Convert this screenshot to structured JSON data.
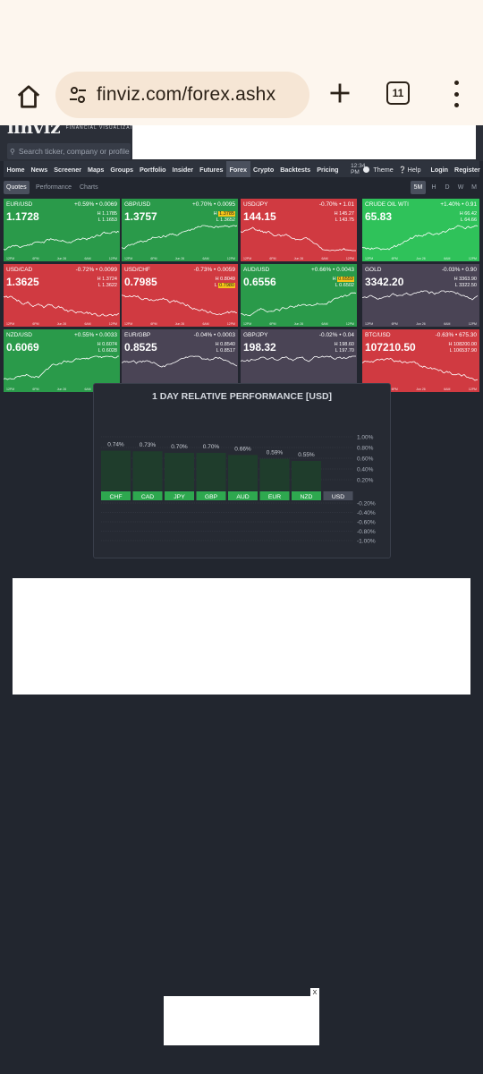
{
  "browser": {
    "url": "finviz.com/forex.ashx",
    "tab_count": "11"
  },
  "header": {
    "logo_text": "finviz",
    "logo_subtitle": "FINANCIAL VISUALIZATIONS",
    "search_placeholder": "Search ticker, company or profile"
  },
  "nav": {
    "items": [
      "Home",
      "News",
      "Screener",
      "Maps",
      "Groups",
      "Portfolio",
      "Insider",
      "Futures",
      "Forex",
      "Crypto",
      "Backtests",
      "Pricing"
    ],
    "active": "Forex",
    "time": "12:34 PM",
    "theme_label": "Theme",
    "help_label": "Help",
    "login_label": "Login",
    "register_label": "Register"
  },
  "subtabs": {
    "items": [
      "Quotes",
      "Performance",
      "Charts"
    ],
    "active": "Quotes",
    "timeframes": [
      "5M",
      "H",
      "D",
      "W",
      "M"
    ],
    "active_timeframe": "5M"
  },
  "axis_ticks": [
    "12PM",
    "6PM",
    "Jun 26",
    "6AM",
    "12PM"
  ],
  "tiles": [
    {
      "name": "EUR/USD",
      "change": "+0.59% • 0.0069",
      "price": "1.1728",
      "high": "1.1785",
      "low": "1.1653",
      "color": "#2a9a4a"
    },
    {
      "name": "GBP/USD",
      "change": "+0.70% • 0.0095",
      "price": "1.3757",
      "high": "1.3785",
      "low": "1.3652",
      "color": "#2a9a4a"
    },
    {
      "name": "USD/JPY",
      "change": "-0.70% • 1.01",
      "price": "144.15",
      "high": "145.27",
      "low": "143.75",
      "color": "#d03a41"
    },
    {
      "name": "CRUDE OIL WTI",
      "change": "+1.40% • 0.91",
      "price": "65.83",
      "high": "66.42",
      "low": "64.66",
      "color": "#2fc25a"
    },
    {
      "name": "USD/CAD",
      "change": "-0.72% • 0.0099",
      "price": "1.3625",
      "high": "1.3724",
      "low": "1.3622",
      "color": "#d03a41"
    },
    {
      "name": "USD/CHF",
      "change": "-0.73% • 0.0059",
      "price": "0.7985",
      "high": "0.8049",
      "low": "0.7980",
      "color": "#d03a41"
    },
    {
      "name": "AUD/USD",
      "change": "+0.66% • 0.0043",
      "price": "0.6556",
      "high": "0.6559",
      "low": "0.6502",
      "color": "#2a9a4a"
    },
    {
      "name": "GOLD",
      "change": "-0.03% • 0.90",
      "price": "3342.20",
      "high": "3363.90",
      "low": "3322.50",
      "color": "#4a4455"
    },
    {
      "name": "NZD/USD",
      "change": "+0.55% • 0.0033",
      "price": "0.6069",
      "high": "0.6074",
      "low": "0.6028",
      "color": "#2a9a4a"
    },
    {
      "name": "EUR/GBP",
      "change": "-0.04% • 0.0003",
      "price": "0.8525",
      "high": "0.8540",
      "low": "0.8517",
      "color": "#4a4455"
    },
    {
      "name": "GBP/JPY",
      "change": "-0.02% • 0.04",
      "price": "198.32",
      "high": "198.60",
      "low": "197.70",
      "color": "#4a4455"
    },
    {
      "name": "BTC/USD",
      "change": "-0.63% • 675.30",
      "price": "107210.50",
      "high": "108200.00",
      "low": "106537.90",
      "color": "#d03a41"
    }
  ],
  "tile_labels": {
    "high": "H",
    "low": "L"
  },
  "chart_data": {
    "type": "bar",
    "title": "1 DAY RELATIVE PERFORMANCE  [USD]",
    "categories": [
      "CHF",
      "CAD",
      "JPY",
      "GBP",
      "AUD",
      "EUR",
      "NZD",
      "USD"
    ],
    "values": [
      0.74,
      0.73,
      0.7,
      0.7,
      0.66,
      0.59,
      0.55,
      0.0
    ],
    "value_labels": [
      "0.74%",
      "0.73%",
      "0.70%",
      "0.70%",
      "0.66%",
      "0.59%",
      "0.55%",
      ""
    ],
    "y_ticks_positive": [
      "1.00%",
      "0.80%",
      "0.60%",
      "0.40%",
      "0.20%"
    ],
    "y_ticks_negative": [
      "-0.20%",
      "-0.40%",
      "-0.60%",
      "-0.80%",
      "-1.00%"
    ],
    "ylim": [
      -1.0,
      1.0
    ],
    "bar_color": "#1f3d2c",
    "label_color": "#2ea84f",
    "usd_label_color": "#4a4f5c"
  }
}
